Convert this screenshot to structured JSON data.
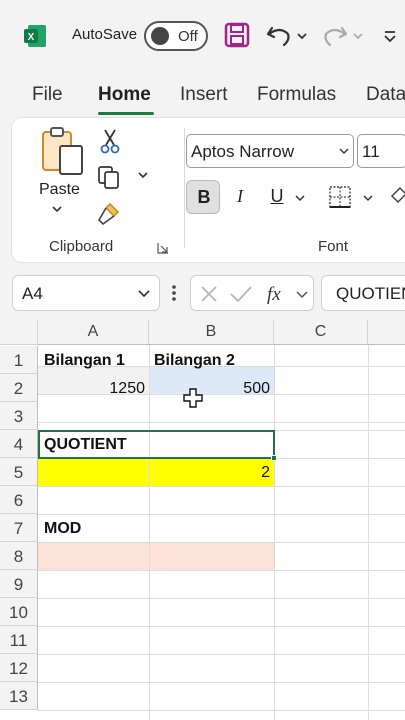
{
  "titlebar": {
    "autosave_label": "AutoSave",
    "toggle_state": "Off"
  },
  "tabs": [
    "File",
    "Home",
    "Insert",
    "Formulas",
    "Data"
  ],
  "ribbon": {
    "paste_label": "Paste",
    "clipboard_label": "Clipboard",
    "font_label": "Font",
    "font_name": "Aptos Narrow",
    "font_size": "11",
    "bold_label": "B",
    "italic_label": "I",
    "underline_label": "U"
  },
  "formula_bar": {
    "name_box": "A4",
    "formula": "QUOTIENT"
  },
  "sheet": {
    "columns": [
      "A",
      "B",
      "C"
    ],
    "rows": [
      "1",
      "2",
      "3",
      "4",
      "5",
      "6",
      "7",
      "8",
      "9",
      "10",
      "11",
      "12",
      "13"
    ],
    "cells": {
      "A1": "Bilangan 1",
      "B1": "Bilangan 2",
      "A2": "1250",
      "B2": "500",
      "A4": "QUOTIENT",
      "B5": "2",
      "A7": "MOD"
    },
    "fills": {
      "A2": "#f2f2f2",
      "B2": "#dde9f7",
      "row5": "#ffff00",
      "row8": "#fbe1d6"
    }
  },
  "colors": {
    "excel_green": "#217346",
    "save_purple": "#a4218b"
  }
}
